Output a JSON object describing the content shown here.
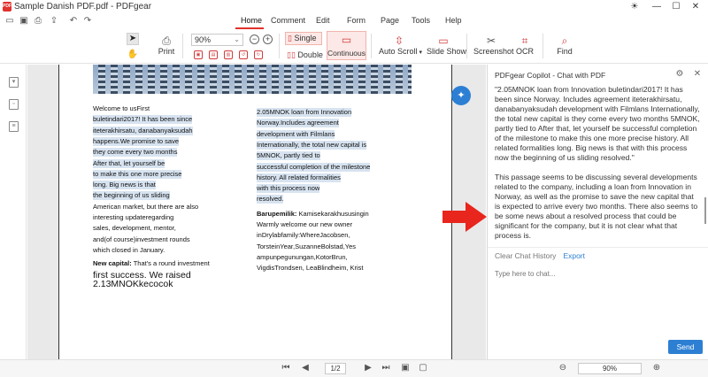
{
  "window": {
    "title": "Sample Danish PDF.pdf - PDFgear",
    "logo_text": "PDF"
  },
  "menu": {
    "tabs": [
      "Home",
      "Comment",
      "Edit",
      "Form",
      "Page",
      "Tools",
      "Help"
    ],
    "active": "Home"
  },
  "ribbon": {
    "print": "Print",
    "zoom_value": "90%",
    "single": "Single",
    "double": "Double",
    "continuous": "Continuous",
    "auto_scroll": "Auto Scroll",
    "slide_show": "Slide Show",
    "screenshot": "Screenshot",
    "ocr": "OCR",
    "find": "Find"
  },
  "document": {
    "left_column": [
      {
        "text": "Welcome to usFirst",
        "hl": false
      },
      {
        "text": "buletindari2017! It has been since",
        "hl": true
      },
      {
        "text": "iteterakhirsatu, danabanyaksudah",
        "hl": true
      },
      {
        "text": "happens.We promise to save",
        "hl": true
      },
      {
        "text": "they come every two months",
        "hl": true
      },
      {
        "text": "After that, let yourself be",
        "hl": true
      },
      {
        "text": "to make this one more precise",
        "hl": true
      },
      {
        "text": "long. Big news is that",
        "hl": true
      },
      {
        "text": "the beginning of us sliding",
        "hl": true
      },
      {
        "text": "American market, but there are also",
        "hl": false
      },
      {
        "text": "interesting updateregarding",
        "hl": false
      },
      {
        "text": "sales, development, mentor,",
        "hl": false
      },
      {
        "text": "and(of course)investment rounds",
        "hl": false
      },
      {
        "text": "which closed in January.",
        "hl": false
      }
    ],
    "new_capital_label": "New capital:",
    "new_capital_text": " That's a round investment",
    "big_line_1": "first success. We raised",
    "big_line_2": "2.13MNOKkecocok",
    "right_column": [
      {
        "text": "2.05MNOK loan from Innovation",
        "hl": true
      },
      {
        "text": "Norway.Includes agreement",
        "hl": true
      },
      {
        "text": "development with Filmlans",
        "hl": true
      },
      {
        "text": "Internationally, the total new capital is",
        "hl": true
      },
      {
        "text": "5MNOK, partly tied to",
        "hl": true
      },
      {
        "text": "successful completion of the milestone",
        "hl": true
      },
      {
        "text": "history. All related formalities",
        "hl": true
      },
      {
        "text": "with this process now",
        "hl": true
      },
      {
        "text": "resolved.",
        "hl": true
      }
    ],
    "barupemilik_label": "Barupemilik:",
    "barupemilik_text": " Kamisekarakhususingin",
    "right_tail": [
      "Warmly welcome our new owner",
      "inDrylabfamily:WhereJacobsen,",
      "TorsteinYear,SuzanneBolstad,Yes",
      "ampunpegunungan,KotorBrun,",
      "VigdisTrondsen, LeaBlindheim, Krist"
    ]
  },
  "chat": {
    "title": "PDFgear Copilot - Chat with PDF",
    "messages": [
      "\"2.05MNOK loan from Innovation buletindari2017! It has been since Norway. Includes agreement iteterakhirsatu, danabanyaksudah development with Filmlans Internationally, the total new capital is they come every two months 5MNOK, partly tied to After that, let yourself be successful completion of the milestone to make this one more precise history. All related formalities long. Big news is that with this process now the beginning of us sliding resolved.\"",
      "This passage seems to be discussing several developments related to the company, including a loan from Innovation in Norway, as well as the promise to save the new capital that is expected to arrive every two months. There also seems to be some news about a resolved process that could be significant for the company, but it is not clear what that process is."
    ],
    "clear_history": "Clear Chat History",
    "export": "Export",
    "input_placeholder": "Type here to chat...",
    "send": "Send"
  },
  "status": {
    "page": "1/2",
    "zoom": "90%"
  },
  "colors": {
    "accent_blue": "#2d7fd3",
    "brand_red": "#e1322d",
    "highlight": "#d7e3f0",
    "arrow_red": "#e8261d"
  }
}
